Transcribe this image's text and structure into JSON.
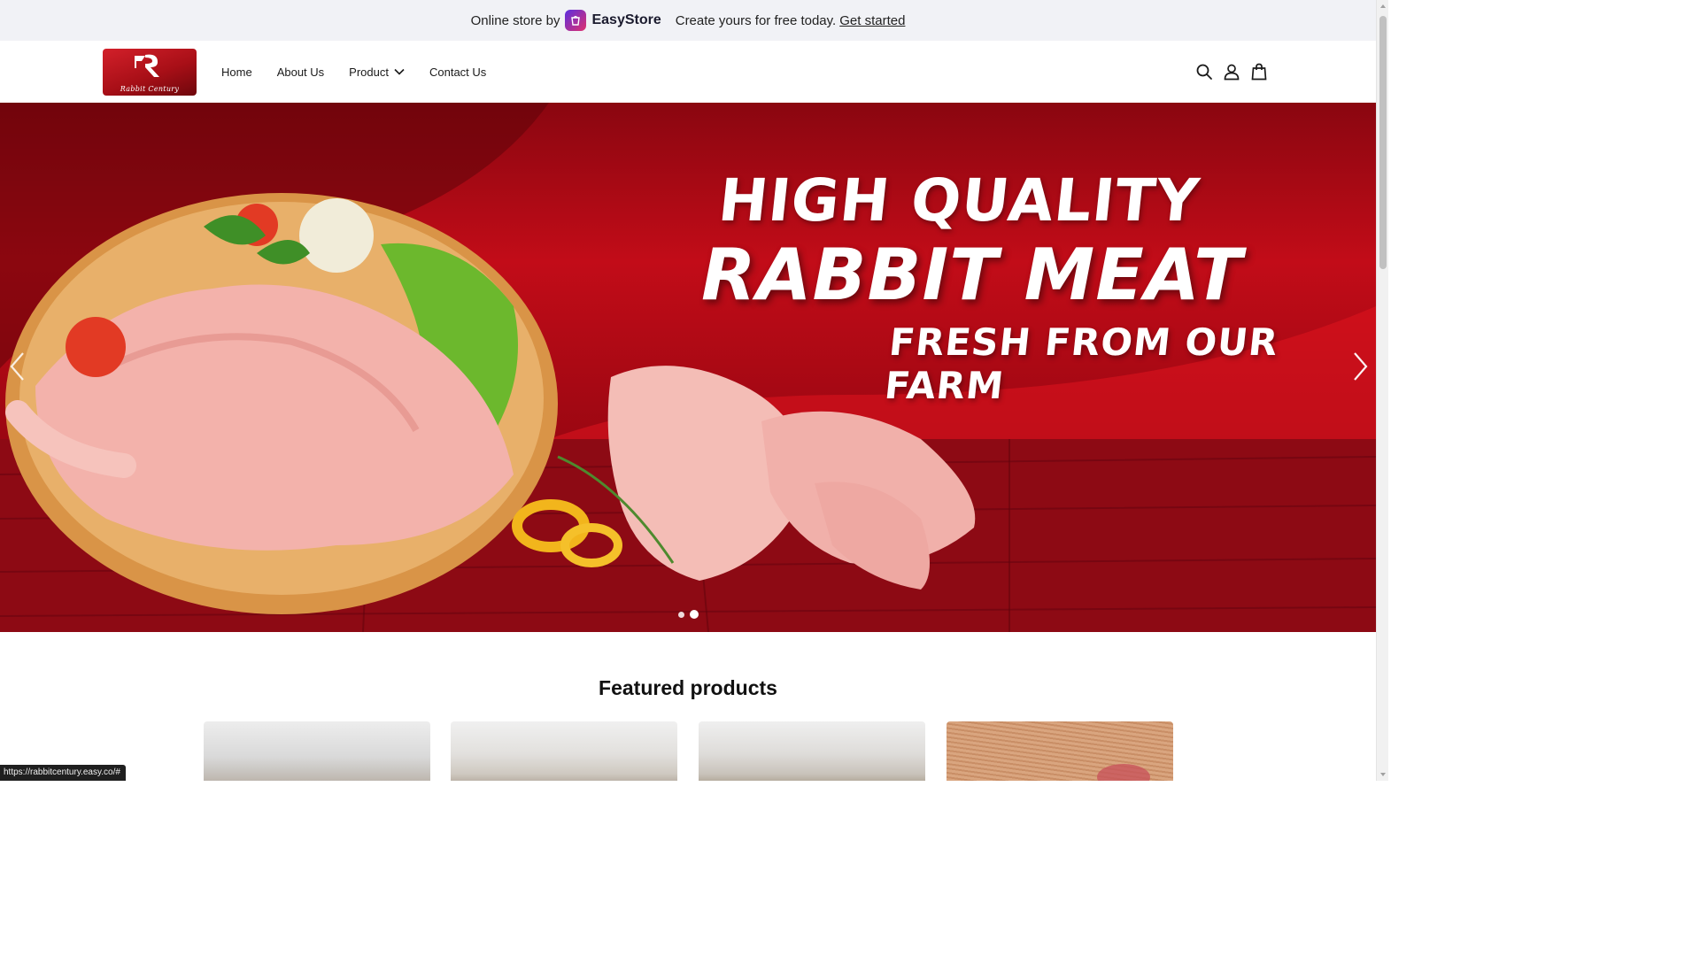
{
  "easystore_bar": {
    "prefix": "Online store by",
    "brand": "EasyStore",
    "cta_text": "Create yours for free today.",
    "cta_link": "Get started"
  },
  "header": {
    "logo_script": "Rabbit Century",
    "nav": [
      {
        "label": "Home"
      },
      {
        "label": "About Us"
      },
      {
        "label": "Product",
        "has_dropdown": true
      },
      {
        "label": "Contact Us"
      }
    ],
    "icons": [
      "search-icon",
      "account-icon",
      "cart-icon"
    ]
  },
  "hero": {
    "line1": "HIGH QUALITY",
    "line2": "RABBIT MEAT",
    "line3": "FRESH FROM OUR FARM",
    "slide_count": 2,
    "active_slide": 2,
    "colors": {
      "accent": "#c20c18",
      "dark": "#7a0710"
    }
  },
  "featured": {
    "title": "Featured products"
  },
  "status_bar": {
    "url": "https://rabbitcentury.easy.co/#"
  }
}
